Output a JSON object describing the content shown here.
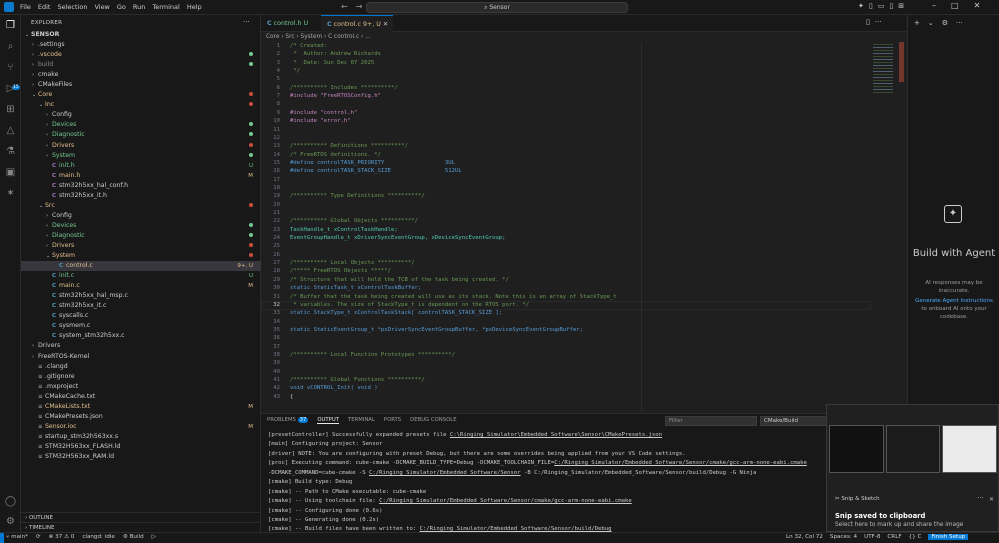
{
  "titlebar": {
    "menu": [
      "File",
      "Edit",
      "Selection",
      "View",
      "Go",
      "Run",
      "Terminal",
      "Help"
    ],
    "search": "Sensor",
    "back": "←",
    "forward": "→"
  },
  "explorer": {
    "header": "EXPLORER",
    "items": [
      {
        "label": "SENSOR",
        "depth": 0,
        "kind": "root",
        "chev": "⌄"
      },
      {
        "label": ".settings",
        "depth": 1,
        "kind": "folder",
        "chev": "›"
      },
      {
        "label": ".vscode",
        "depth": 1,
        "kind": "folder",
        "chev": "›",
        "color": "#e2c08d",
        "dot": "#73c991"
      },
      {
        "label": "build",
        "depth": 1,
        "kind": "folder",
        "chev": "›",
        "color": "#8b8b8b",
        "dot": "#73c991"
      },
      {
        "label": "cmake",
        "depth": 1,
        "kind": "folder",
        "chev": "›"
      },
      {
        "label": "CMakeFiles",
        "depth": 1,
        "kind": "folder",
        "chev": "›"
      },
      {
        "label": "Core",
        "depth": 1,
        "kind": "folder",
        "chev": "⌄",
        "color": "#e2c08d",
        "dot": "#c74e39"
      },
      {
        "label": "Inc",
        "depth": 2,
        "kind": "folder",
        "chev": "⌄",
        "color": "#e2c08d",
        "dot": "#c74e39"
      },
      {
        "label": "Config",
        "depth": 3,
        "kind": "folder",
        "chev": "›"
      },
      {
        "label": "Devices",
        "depth": 3,
        "kind": "folder",
        "chev": "›",
        "color": "#73c991",
        "dot": "#73c991"
      },
      {
        "label": "Diagnostic",
        "depth": 3,
        "kind": "folder",
        "chev": "›",
        "color": "#73c991",
        "dot": "#73c991"
      },
      {
        "label": "Drivers",
        "depth": 3,
        "kind": "folder",
        "chev": "›",
        "color": "#e2c08d",
        "dot": "#c74e39"
      },
      {
        "label": "System",
        "depth": 3,
        "kind": "folder",
        "chev": "›",
        "color": "#73c991",
        "dot": "#73c991"
      },
      {
        "label": "init.h",
        "depth": 3,
        "kind": "h",
        "color": "#73c991",
        "mark": "U"
      },
      {
        "label": "main.h",
        "depth": 3,
        "kind": "h",
        "color": "#e2c08d",
        "mark": "M"
      },
      {
        "label": "stm32h5xx_hal_conf.h",
        "depth": 3,
        "kind": "h"
      },
      {
        "label": "stm32h5xx_it.h",
        "depth": 3,
        "kind": "h"
      },
      {
        "label": "Src",
        "depth": 2,
        "kind": "folder",
        "chev": "⌄",
        "color": "#e2c08d",
        "dot": "#c74e39"
      },
      {
        "label": "Config",
        "depth": 3,
        "kind": "folder",
        "chev": "›"
      },
      {
        "label": "Devices",
        "depth": 3,
        "kind": "folder",
        "chev": "›",
        "color": "#73c991",
        "dot": "#73c991"
      },
      {
        "label": "Diagnostic",
        "depth": 3,
        "kind": "folder",
        "chev": "›",
        "color": "#73c991",
        "dot": "#73c991"
      },
      {
        "label": "Drivers",
        "depth": 3,
        "kind": "folder",
        "chev": "›",
        "color": "#e2c08d",
        "dot": "#c74e39"
      },
      {
        "label": "System",
        "depth": 3,
        "kind": "folder",
        "chev": "⌄",
        "color": "#e2c08d",
        "dot": "#c74e39"
      },
      {
        "label": "control.c",
        "depth": 4,
        "kind": "c",
        "color": "#e2c08d",
        "mark": "9+, U",
        "selected": true
      },
      {
        "label": "init.c",
        "depth": 3,
        "kind": "c",
        "color": "#73c991",
        "mark": "U"
      },
      {
        "label": "main.c",
        "depth": 3,
        "kind": "c",
        "color": "#e2c08d",
        "mark": "M"
      },
      {
        "label": "stm32h5xx_hal_msp.c",
        "depth": 3,
        "kind": "c"
      },
      {
        "label": "stm32h5xx_it.c",
        "depth": 3,
        "kind": "c"
      },
      {
        "label": "syscalls.c",
        "depth": 3,
        "kind": "c"
      },
      {
        "label": "sysmem.c",
        "depth": 3,
        "kind": "c"
      },
      {
        "label": "system_stm32h5xx.c",
        "depth": 3,
        "kind": "c"
      },
      {
        "label": "Drivers",
        "depth": 1,
        "kind": "folder",
        "chev": "›"
      },
      {
        "label": "FreeRTOS-Kernel",
        "depth": 1,
        "kind": "folder",
        "chev": "›"
      },
      {
        "label": ".clangd",
        "depth": 1,
        "kind": "file"
      },
      {
        "label": ".gitignore",
        "depth": 1,
        "kind": "file"
      },
      {
        "label": ".mxproject",
        "depth": 1,
        "kind": "file"
      },
      {
        "label": "CMakeCache.txt",
        "depth": 1,
        "kind": "file"
      },
      {
        "label": "CMakeLists.txt",
        "depth": 1,
        "kind": "file",
        "color": "#e2c08d",
        "mark": "M"
      },
      {
        "label": "CMakePresets.json",
        "depth": 1,
        "kind": "file"
      },
      {
        "label": "Sensor.ioc",
        "depth": 1,
        "kind": "file",
        "color": "#e2c08d",
        "mark": "M"
      },
      {
        "label": "startup_stm32h563xx.s",
        "depth": 1,
        "kind": "file"
      },
      {
        "label": "STM32H563xx_FLASH.ld",
        "depth": 1,
        "kind": "file"
      },
      {
        "label": "STM32H563xx_RAM.ld",
        "depth": 1,
        "kind": "file"
      }
    ],
    "outline": "OUTLINE",
    "timeline": "TIMELINE"
  },
  "tabs": [
    {
      "label": "control.h",
      "mark": "U",
      "active": false
    },
    {
      "label": "control.c",
      "mark": "9+, U",
      "active": true
    }
  ],
  "breadcrumb": "Core › Src › System › C  control.c › ...",
  "editor": {
    "lines": [
      {
        "n": "1",
        "t": "/* Created:",
        "c": "com"
      },
      {
        "n": "2",
        "t": " *  Author: Andrew Richards",
        "c": "com"
      },
      {
        "n": "3",
        "t": " *  Date: Sun Dec 07 2025",
        "c": "com"
      },
      {
        "n": "4",
        "t": " */",
        "c": "com"
      },
      {
        "n": "5",
        "t": "",
        "c": ""
      },
      {
        "n": "6",
        "t": "/********** Includes **********/",
        "c": "com"
      },
      {
        "n": "7",
        "t": "#include \"FreeRTOSConfig.h\"",
        "c": "inc"
      },
      {
        "n": "8",
        "t": "",
        "c": ""
      },
      {
        "n": "9",
        "t": "#include \"control.h\"",
        "c": "inc"
      },
      {
        "n": "10",
        "t": "#include \"error.h\"",
        "c": "inc"
      },
      {
        "n": "11",
        "t": "",
        "c": ""
      },
      {
        "n": "12",
        "t": "",
        "c": ""
      },
      {
        "n": "13",
        "t": "/********** Definitions **********/",
        "c": "com"
      },
      {
        "n": "14",
        "t": "/* FreeRTOS definitions. */",
        "c": "com"
      },
      {
        "n": "15",
        "t": "#define controlTASK_PRIORITY                  3UL",
        "c": "def"
      },
      {
        "n": "16",
        "t": "#define controlTASK_STACK_SIZE                512UL",
        "c": "def"
      },
      {
        "n": "17",
        "t": "",
        "c": ""
      },
      {
        "n": "18",
        "t": "",
        "c": ""
      },
      {
        "n": "19",
        "t": "/********** Type Definitions **********/",
        "c": "com"
      },
      {
        "n": "20",
        "t": "",
        "c": ""
      },
      {
        "n": "21",
        "t": "",
        "c": ""
      },
      {
        "n": "22",
        "t": "/********** Global Objects **********/",
        "c": "com"
      },
      {
        "n": "23",
        "t": "TaskHandle_t xControlTaskHandle;",
        "c": "decl"
      },
      {
        "n": "24",
        "t": "EventGroupHandle_t xDriverSyncEventGroup, xDeviceSyncEventGroup;",
        "c": "decl"
      },
      {
        "n": "25",
        "t": "",
        "c": ""
      },
      {
        "n": "26",
        "t": "",
        "c": ""
      },
      {
        "n": "27",
        "t": "/********** Local Objects **********/",
        "c": "com"
      },
      {
        "n": "28",
        "t": "/***** FreeRTOS Objects *****/",
        "c": "com"
      },
      {
        "n": "29",
        "t": "/* Structure that will hold the TCB of the task being created. */",
        "c": "com"
      },
      {
        "n": "30",
        "t": "static StaticTask_t xControlTaskBuffer;",
        "c": "stat"
      },
      {
        "n": "31",
        "t": "/* Buffer that the task being created will use as its stack. Note this is an array of StackType_t",
        "c": "com"
      },
      {
        "n": "32",
        "t": " * variables. The size of StackType_t is dependent on the RTOS port. */",
        "c": "com"
      },
      {
        "n": "33",
        "t": "static StackType_t xControlTaskStack[ controlTASK_STACK_SIZE ];",
        "c": "stat"
      },
      {
        "n": "34",
        "t": "",
        "c": ""
      },
      {
        "n": "35",
        "t": "static StaticEventGroup_t *pxDriverSyncEventGroupBuffer, *pxDeviceSyncEventGroupBuffer;",
        "c": "stat"
      },
      {
        "n": "36",
        "t": "",
        "c": ""
      },
      {
        "n": "37",
        "t": "",
        "c": ""
      },
      {
        "n": "38",
        "t": "/********** Local Function Prototypes **********/",
        "c": "com"
      },
      {
        "n": "39",
        "t": "",
        "c": ""
      },
      {
        "n": "40",
        "t": "",
        "c": ""
      },
      {
        "n": "41",
        "t": "/********** Global Functions **********/",
        "c": "com"
      },
      {
        "n": "42",
        "t": "void vCONTROL_Init( void )",
        "c": "fn"
      },
      {
        "n": "43",
        "t": "{",
        "c": ""
      }
    ]
  },
  "agent": {
    "title": "Build with Agent",
    "note": "AI responses may be inaccurate.",
    "link": "Generate Agent Instructions",
    "link_tail": " to onboard AI onto your codebase."
  },
  "panel": {
    "tabs": [
      {
        "label": "PROBLEMS",
        "badge": "37"
      },
      {
        "label": "OUTPUT",
        "active": true
      },
      {
        "label": "TERMINAL"
      },
      {
        "label": "PORTS"
      },
      {
        "label": "DEBUG CONSOLE"
      }
    ],
    "filter_placeholder": "Filter",
    "select": "CMake/Build",
    "output": [
      {
        "pre": "[presetController] Successfully expanded presets file ",
        "link": "C:\\Ringing_Simulator\\Embedded_Software\\Sensor\\CMakePresets.json",
        "post": ""
      },
      {
        "pre": "[main] Configuring project: Sensor",
        "link": "",
        "post": ""
      },
      {
        "pre": "[driver] NOTE: You are configuring with preset Debug, but there are some overrides being applied from your VS Code settings.",
        "link": "",
        "post": ""
      },
      {
        "pre": "[proc] Executing command: cube-cmake -DCMAKE_BUILD_TYPE=Debug -DCMAKE_TOOLCHAIN_FILE=",
        "link": "C:/Ringing_Simulator/Embedded_Software/Sensor/cmake/gcc-arm-none-eabi.cmake",
        "post": ""
      },
      {
        "pre": "-DCMAKE_COMMAND=cube-cmake -S ",
        "link": "C:/Ringing_Simulator/Embedded_Software/Sensor",
        "post": " -B C:/Ringing_Simulator/Embedded_Software/Sensor/build/Debug -G Ninja"
      },
      {
        "pre": "[cmake] Build type: Debug",
        "link": "",
        "post": ""
      },
      {
        "pre": "[cmake] -- Path to CMake executable: cube-cmake",
        "link": "",
        "post": ""
      },
      {
        "pre": "[cmake] -- Using toolchain file: ",
        "link": "C:/Ringing_Simulator/Embedded_Software/Sensor/cmake/gcc-arm-none-eabi.cmake",
        "post": ""
      },
      {
        "pre": "[cmake] -- Configuring done (0.6s)",
        "link": "",
        "post": ""
      },
      {
        "pre": "[cmake] -- Generating done (0.2s)",
        "link": "",
        "post": ""
      },
      {
        "pre": "[cmake] -- Build files have been written to: ",
        "link": "C:/Ringing_Simulator/Embedded_Software/Sensor/build/Debug",
        "post": ""
      }
    ]
  },
  "status": {
    "branch": "main*",
    "sync": "⟳",
    "problems": "⊗ 37 ⚠ 0",
    "clangd": "clangd: idle",
    "build": "⚙ Build",
    "play": "▷",
    "ln": "Ln 32, Col 72",
    "spaces": "Spaces: 4",
    "enc": "UTF-8",
    "eol": "CRLF",
    "lang": "{} C",
    "finish": "Finish Setup"
  },
  "toast": {
    "app": "Snip & Sketch",
    "title": "Snip saved to clipboard",
    "msg": "Select here to mark up and share the image",
    "close": "✕",
    "more": "···"
  },
  "colors": {
    "accent": "#0078d4",
    "modified": "#e2c08d",
    "untracked": "#73c991",
    "error": "#c74e39"
  }
}
